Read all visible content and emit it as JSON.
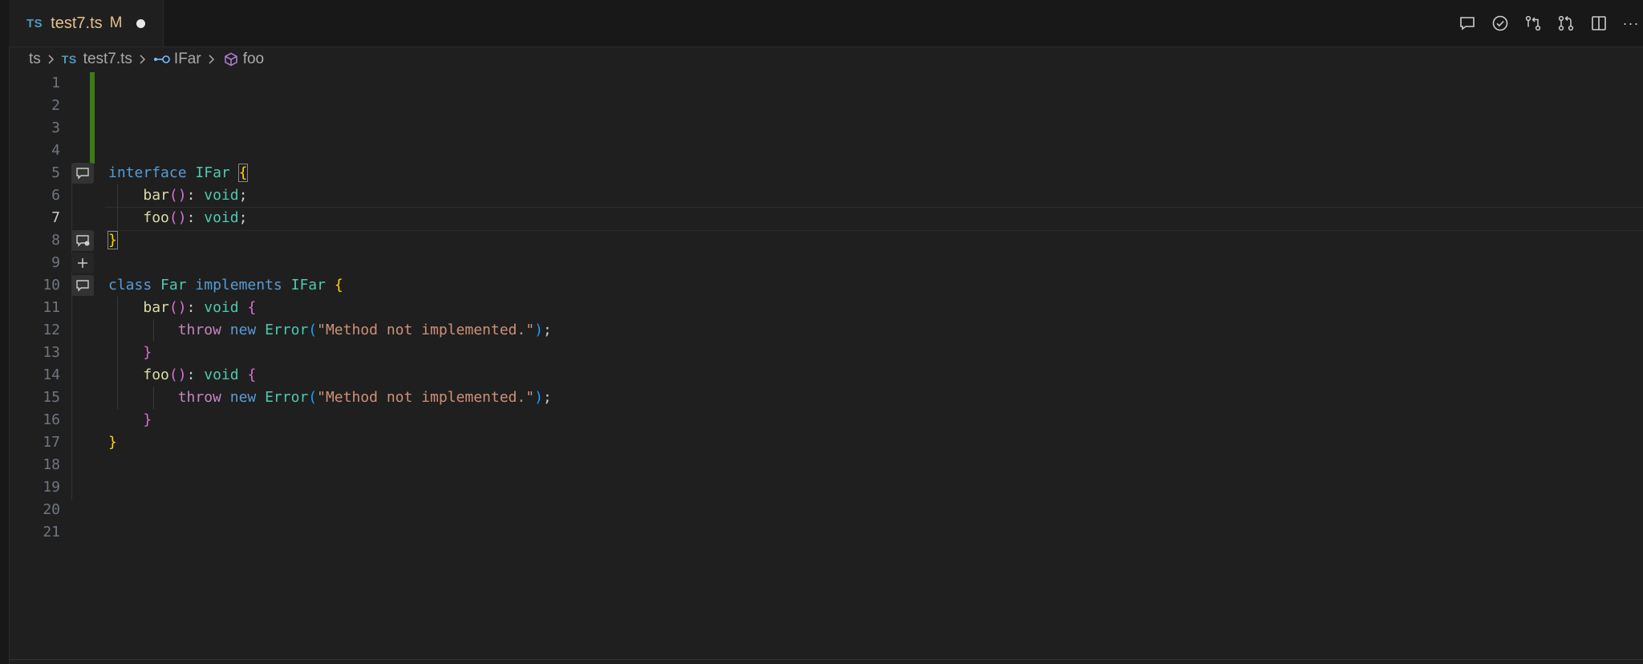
{
  "tab": {
    "lang_badge": "TS",
    "file_name": "test7.ts",
    "modified_flag": "M"
  },
  "toolbar": {
    "icons": [
      "comment-icon",
      "check-icon",
      "compare-changes-icon",
      "pull-request-icon",
      "split-editor-icon",
      "more-icon"
    ],
    "more_glyph": "···"
  },
  "breadcrumb": {
    "folder": "ts",
    "lang_badge": "TS",
    "file": "test7.ts",
    "interface": "IFar",
    "method": "foo"
  },
  "editor": {
    "active_line": 7,
    "line_numbers": [
      "1",
      "2",
      "3",
      "4",
      "5",
      "6",
      "7",
      "8",
      "9",
      "10",
      "11",
      "12",
      "13",
      "14",
      "15",
      "16",
      "17",
      "18",
      "19",
      "20",
      "21"
    ],
    "lines": [
      "",
      "",
      "",
      "",
      "interface IFar {",
      "    bar(): void;",
      "    foo(): void;",
      "}",
      "",
      "class Far implements IFar {",
      "    bar(): void {",
      "        throw new Error(\"Method not implemented.\");",
      "    }",
      "    foo(): void {",
      "        throw new Error(\"Method not implemented.\");",
      "    }",
      "}",
      "",
      "",
      "",
      ""
    ]
  },
  "colors": {
    "background": "#1f1f1f",
    "git_added": "#3e7a15",
    "keyword": "#569cd6",
    "control_keyword": "#c586c0",
    "type": "#4ec9b0",
    "function": "#dcdcaa",
    "string": "#ce9178"
  }
}
